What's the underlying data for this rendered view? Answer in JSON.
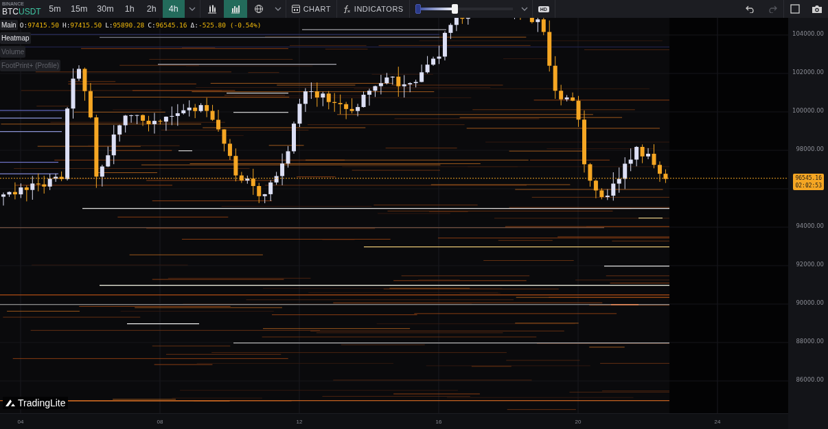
{
  "toolbar": {
    "exchange": "BINANCE",
    "symbol_base": "BTC",
    "symbol_quote": "USDT",
    "timeframes": [
      {
        "label": "5m",
        "selected": false
      },
      {
        "label": "15m",
        "selected": false
      },
      {
        "label": "30m",
        "selected": false
      },
      {
        "label": "1h",
        "selected": false
      },
      {
        "label": "2h",
        "selected": false
      },
      {
        "label": "4h",
        "selected": true
      }
    ],
    "chart_styles": [
      {
        "kind": "candles",
        "selected": false
      },
      {
        "kind": "bars",
        "selected": true
      }
    ],
    "chart_button": "CHART",
    "indicators_button": "INDICATORS",
    "slider": {
      "level": 0.41
    },
    "hd_button": "HD"
  },
  "legend": {
    "pane": "Main",
    "values": [
      {
        "label": "O:",
        "value": "97415.50"
      },
      {
        "label": "H:",
        "value": "97415.50"
      },
      {
        "label": "L:",
        "value": "95890.28"
      },
      {
        "label": "C:",
        "value": "96545.16"
      },
      {
        "label": "Δ:",
        "value": "-525.80 (-0.54%)"
      }
    ]
  },
  "layers": [
    {
      "label": "Heatmap",
      "enabled": true
    },
    {
      "label": "Volume",
      "enabled": false
    },
    {
      "label": "FootPrint+ (Profile)",
      "enabled": false
    }
  ],
  "price_axis": [
    "104000.00",
    "102000.00",
    "100000.00",
    "98000.00",
    "94000.00",
    "92000.00",
    "90000.00",
    "88000.00",
    "86000.00"
  ],
  "current_price": {
    "price": "96545.16",
    "countdown": "02:02:53"
  },
  "time_axis": [
    "04",
    "08",
    "12",
    "16",
    "20",
    "24"
  ],
  "logo": "TradingLite"
}
